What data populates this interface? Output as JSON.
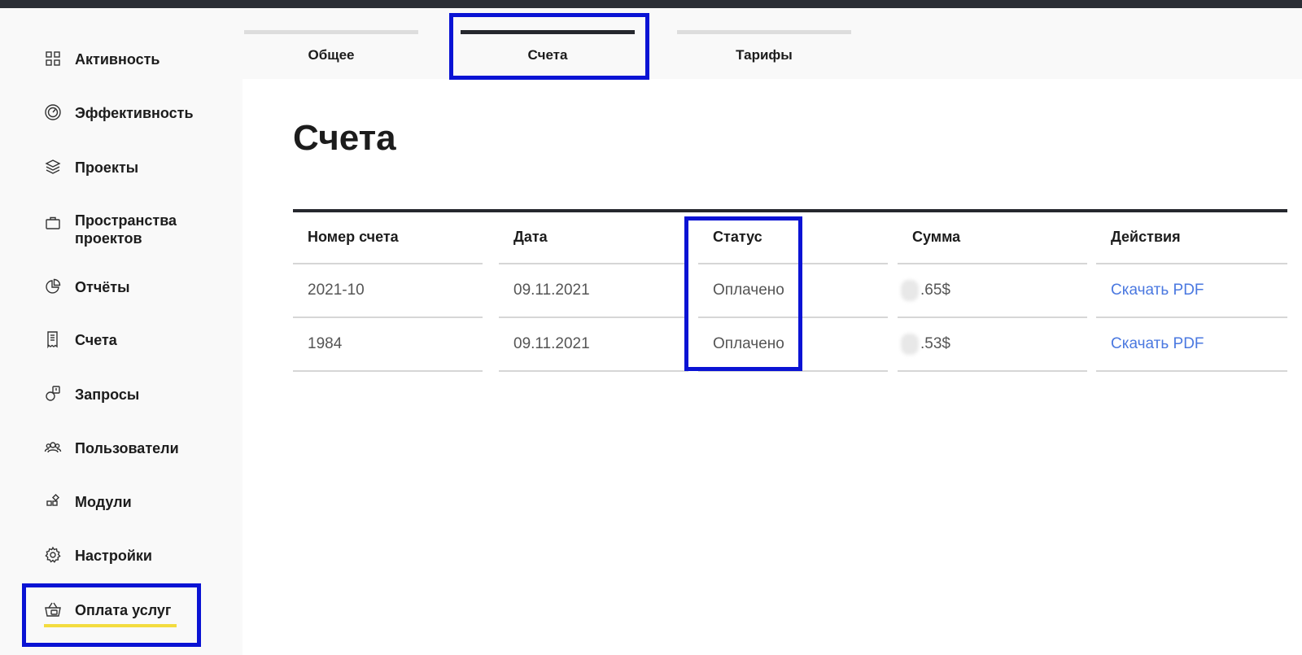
{
  "sidebar": {
    "items": [
      {
        "label": "Активность",
        "icon": "grid-icon"
      },
      {
        "label": "Эффективность",
        "icon": "gauge-icon"
      },
      {
        "label": "Проекты",
        "icon": "layers-icon"
      },
      {
        "label": "Пространства проектов",
        "icon": "briefcase-icon"
      },
      {
        "label": "Отчёты",
        "icon": "pie-chart-icon"
      },
      {
        "label": "Счета",
        "icon": "receipt-icon"
      },
      {
        "label": "Запросы",
        "icon": "request-icon"
      },
      {
        "label": "Пользователи",
        "icon": "users-icon"
      },
      {
        "label": "Модули",
        "icon": "modules-icon"
      },
      {
        "label": "Настройки",
        "icon": "gear-icon"
      },
      {
        "label": "Оплата услуг",
        "icon": "basket-icon"
      }
    ]
  },
  "tabs": [
    {
      "label": "Общее"
    },
    {
      "label": "Счета",
      "active": true
    },
    {
      "label": "Тарифы"
    }
  ],
  "main": {
    "title": "Счета",
    "table": {
      "headers": [
        "Номер счета",
        "Дата",
        "Статус",
        "Сумма",
        "Действия"
      ],
      "rows": [
        {
          "number": "2021-10",
          "date": "09.11.2021",
          "status": "Оплачено",
          "amount": ".65$",
          "action": "Скачать PDF"
        },
        {
          "number": "1984",
          "date": "09.11.2021",
          "status": "Оплачено",
          "amount": ".53$",
          "action": "Скачать PDF"
        }
      ]
    }
  },
  "colors": {
    "highlight": "#0a13d4",
    "accent_underline": "#f3dc3f",
    "link": "#4a78e0"
  }
}
